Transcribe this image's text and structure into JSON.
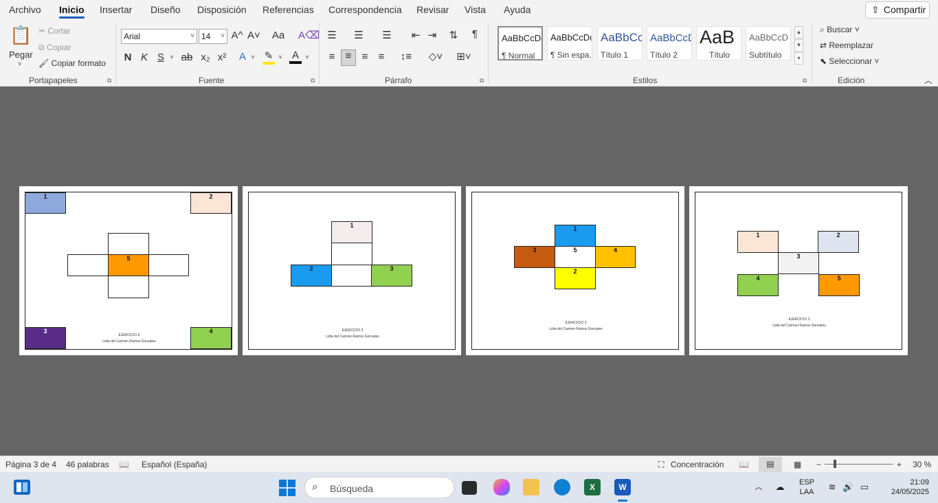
{
  "tabs": [
    "Archivo",
    "Inicio",
    "Insertar",
    "Diseño",
    "Disposición",
    "Referencias",
    "Correspondencia",
    "Revisar",
    "Vista",
    "Ayuda"
  ],
  "share_label": "Compartir",
  "clipboard": {
    "paste": "Pegar",
    "cut": "Cortar",
    "copy": "Copiar",
    "format_painter": "Copiar formato",
    "label": "Portapapeles"
  },
  "font": {
    "family": "Arial",
    "size": "14",
    "grow": "A^",
    "shrink": "A˅",
    "case": "Aa",
    "bold": "N",
    "italic": "K",
    "underline": "S",
    "strike": "ab",
    "subscript": "x₂",
    "superscript": "x²",
    "label": "Fuente"
  },
  "paragraph": {
    "label": "Párrafo"
  },
  "styles": {
    "label": "Estilos",
    "items": [
      {
        "preview": "AaBbCcDc",
        "name": "¶ Normal"
      },
      {
        "preview": "AaBbCcDc",
        "name": "¶ Sin espa..."
      },
      {
        "preview": "AaBbCc",
        "name": "Título 1"
      },
      {
        "preview": "AaBbCcD",
        "name": "Título 2"
      },
      {
        "preview": "AaB",
        "name": "Título"
      },
      {
        "preview": "AaBbCcD",
        "name": "Subtítulo"
      }
    ]
  },
  "editing": {
    "find": "Buscar",
    "replace": "Reemplazar",
    "select": "Seleccionar",
    "label": "Edición"
  },
  "pages": [
    {
      "caption_title": "EJERCICIO 5",
      "caption_author": "Lidia del Carmen Ramos Gonzales",
      "cells": [
        "1",
        "2",
        "5",
        "3",
        "4"
      ]
    },
    {
      "caption_title": "EJERCICIO 3",
      "caption_author": "Lidia del Carmen Ramos Gonzales",
      "cells": [
        "1",
        "2",
        "3"
      ]
    },
    {
      "caption_title": "EJERCICIO 3",
      "caption_author": "Lidia del Carmen Ramos Gonzales",
      "cells": [
        "1",
        "3",
        "5",
        "4",
        "2"
      ]
    },
    {
      "caption_title": "EJERCICIO 3",
      "caption_author": "Lidia del Carmen Ramos Gonzales",
      "cells": [
        "1",
        "2",
        "3",
        "4",
        "5"
      ]
    }
  ],
  "colors": {
    "blue_gray": "#8ea9db",
    "peach": "#fbe5d6",
    "orange": "#ff9900",
    "purple": "#5b2c86",
    "green": "#92d050",
    "light_pink": "#f5eded",
    "sky_blue": "#1a9bf0",
    "brown": "#c55a11",
    "gold": "#ffc000",
    "yellow": "#ffff00",
    "light_blue_gray": "#dde4f0",
    "light_gray": "#f2f2f2"
  },
  "status": {
    "page": "Página 3 de 4",
    "words": "46 palabras",
    "language": "Español (España)",
    "focus": "Concentración",
    "zoom": "30 %"
  },
  "taskbar": {
    "search_placeholder": "Búsqueda",
    "lang_top": "ESP",
    "lang_bottom": "LAA",
    "time": "21:09",
    "date": "24/05/2025"
  }
}
